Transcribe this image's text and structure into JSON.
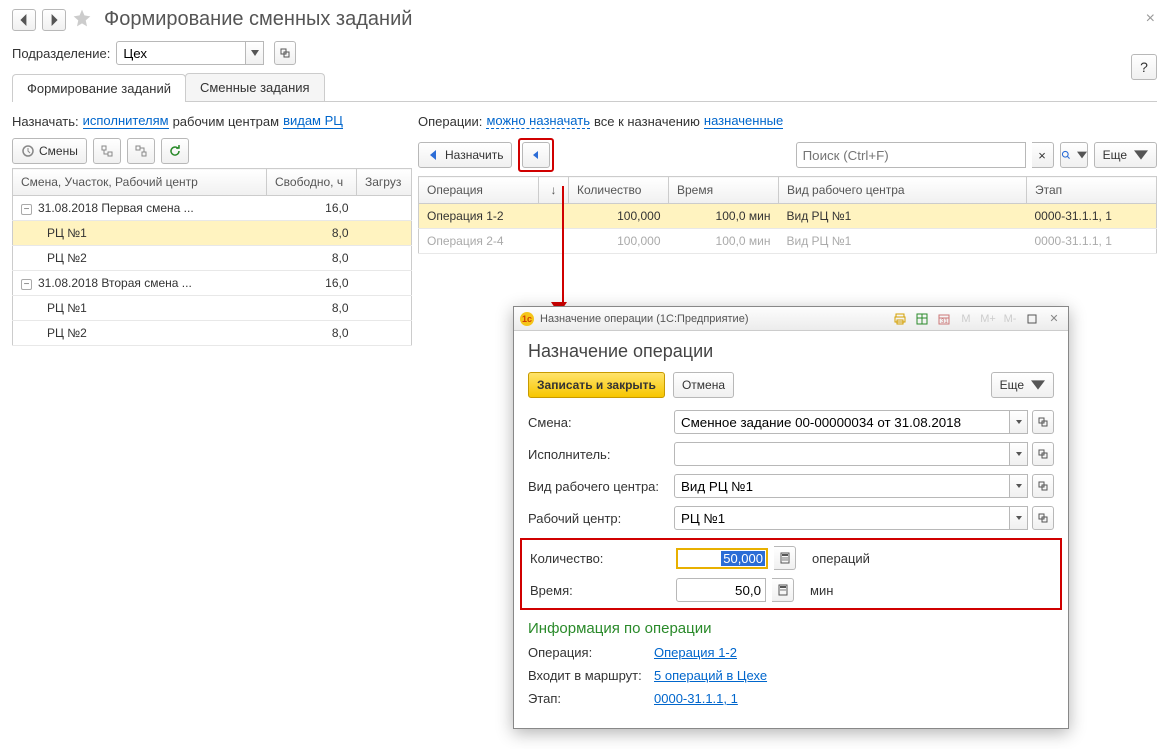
{
  "header": {
    "title": "Формирование сменных заданий",
    "close": "×",
    "help": "?"
  },
  "subdiv": {
    "label": "Подразделение:",
    "value": "Цех"
  },
  "tabs": [
    {
      "label": "Формирование заданий",
      "active": true
    },
    {
      "label": "Сменные задания",
      "active": false
    }
  ],
  "left": {
    "assign_label": "Назначать:",
    "link_performers": "исполнителям",
    "plain_wc": "рабочим центрам",
    "link_wctypes": "видам РЦ",
    "btn_shifts": "Смены",
    "grid": {
      "cols": [
        "Смена, Участок, Рабочий центр",
        "Свободно, ч",
        "Загруз"
      ],
      "rows": [
        {
          "indent": 0,
          "exp": true,
          "text": "31.08.2018 Первая смена ...",
          "free": "16,0",
          "load": ""
        },
        {
          "indent": 1,
          "sel": true,
          "text": "РЦ №1",
          "free": "8,0",
          "load": ""
        },
        {
          "indent": 1,
          "text": "РЦ №2",
          "free": "8,0",
          "load": ""
        },
        {
          "indent": 0,
          "exp": true,
          "text": "31.08.2018 Вторая смена ...",
          "free": "16,0",
          "load": ""
        },
        {
          "indent": 1,
          "text": "РЦ №1",
          "free": "8,0",
          "load": ""
        },
        {
          "indent": 1,
          "text": "РЦ №2",
          "free": "8,0",
          "load": ""
        }
      ]
    }
  },
  "right": {
    "ops_label": "Операции:",
    "link_can": "можно назначать",
    "plain_all": "все к назначению",
    "link_assigned": "назначенные",
    "btn_assign": "Назначить",
    "search_placeholder": "Поиск (Ctrl+F)",
    "btn_more": "Еще",
    "grid": {
      "cols": [
        "Операция",
        "↓",
        "Количество",
        "Время",
        "Вид рабочего центра",
        "Этап"
      ],
      "rows": [
        {
          "sel": true,
          "op": "Операция 1-2",
          "qty": "100,000",
          "time": "100,0 мин",
          "wc": "Вид РЦ №1",
          "stage": "0000-31.1.1, 1"
        },
        {
          "disabled": true,
          "op": "Операция 2-4",
          "qty": "100,000",
          "time": "100,0 мин",
          "wc": "Вид РЦ №1",
          "stage": "0000-31.1.1, 1"
        }
      ]
    }
  },
  "dialog": {
    "win_title": "Назначение операции  (1С:Предприятие)",
    "title": "Назначение операции",
    "btn_save": "Записать и закрыть",
    "btn_cancel": "Отмена",
    "btn_more": "Еще",
    "fields": {
      "shift_l": "Смена:",
      "shift_v": "Сменное задание 00-00000034 от 31.08.2018",
      "perf_l": "Исполнитель:",
      "perf_v": "",
      "wct_l": "Вид рабочего центра:",
      "wct_v": "Вид РЦ №1",
      "wc_l": "Рабочий центр:",
      "wc_v": "РЦ №1",
      "qty_l": "Количество:",
      "qty_v": "50,000",
      "qty_unit": "операций",
      "time_l": "Время:",
      "time_v": "50,0",
      "time_unit": "мин"
    },
    "info_h": "Информация по операции",
    "info": {
      "op_l": "Операция:",
      "op_v": "Операция 1-2",
      "route_l": "Входит в маршрут:",
      "route_v": "5 операций в Цехе",
      "stage_l": "Этап:",
      "stage_v": "0000-31.1.1, 1"
    }
  }
}
